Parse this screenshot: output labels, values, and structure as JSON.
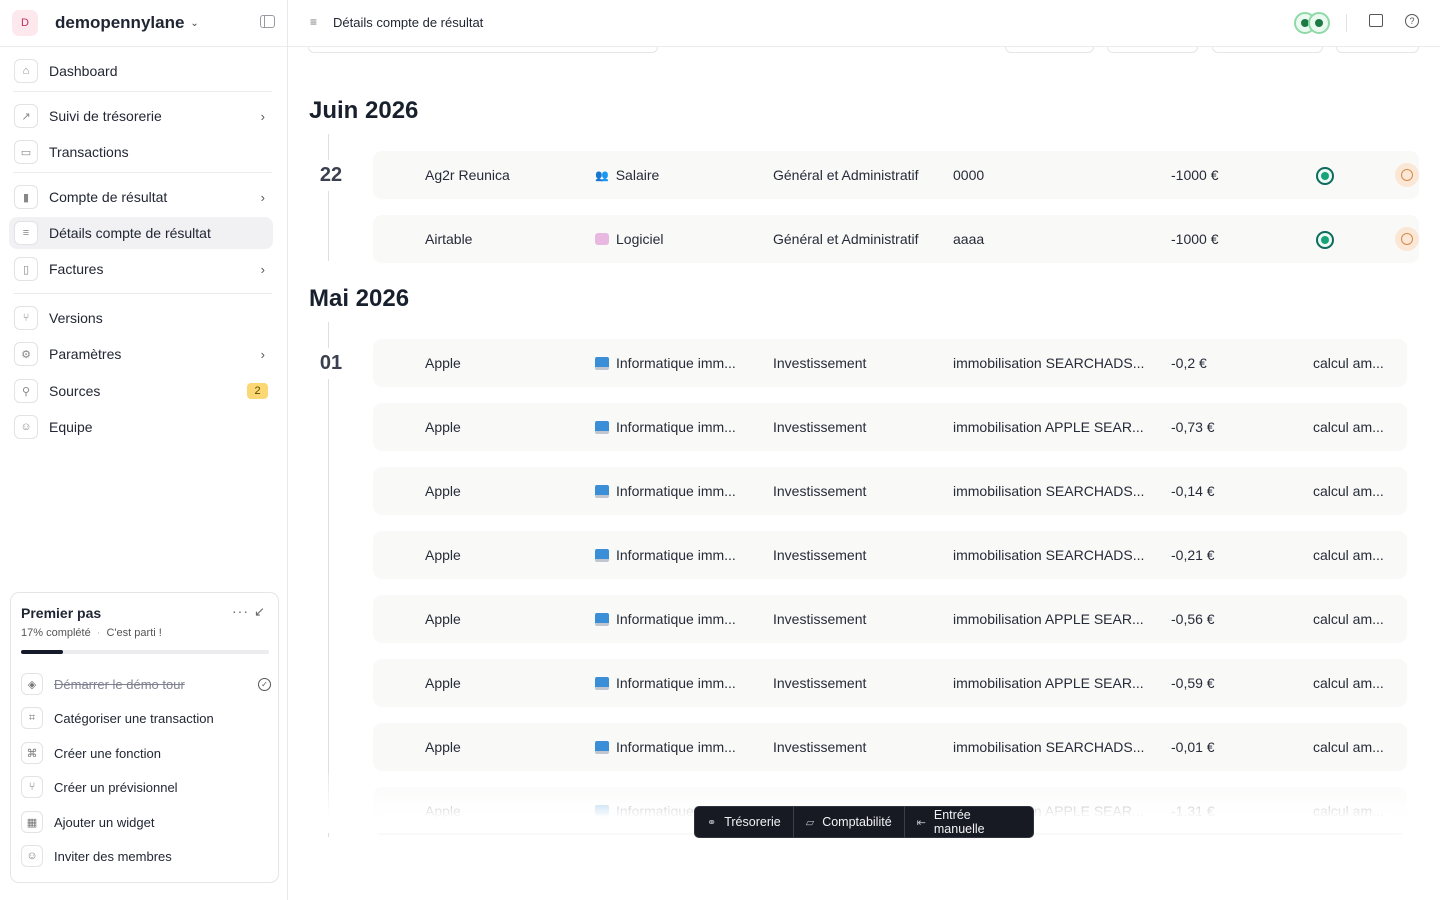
{
  "workspace": {
    "avatar": "D",
    "name": "demopennylane"
  },
  "nav": {
    "dashboard": "Dashboard",
    "suivi": "Suivi de trésorerie",
    "transactions": "Transactions",
    "compte": "Compte de résultat",
    "details": "Détails compte de résultat",
    "factures": "Factures",
    "versions": "Versions",
    "parametres": "Paramètres",
    "sources": "Sources",
    "sources_badge": "2",
    "equipe": "Equipe"
  },
  "onboarding": {
    "title": "Premier pas",
    "progress_text": "17% complété",
    "progress_sub": "C'est parti !",
    "progress": 0.17,
    "items": [
      "Démarrer le démo tour",
      "Catégoriser une transaction",
      "Créer une fonction",
      "Créer un prévisionnel",
      "Ajouter un widget",
      "Inviter des membres"
    ]
  },
  "header": {
    "title": "Détails compte de résultat"
  },
  "sections": [
    {
      "month": "Juin 2026",
      "day": "22",
      "rows": [
        {
          "name": "Ag2r Reunica",
          "category": "Salaire",
          "group": "Général et Administratif",
          "description": "0000",
          "amount": "-1000 €",
          "note": ""
        },
        {
          "name": "Airtable",
          "category": "Logiciel",
          "group": "Général et Administratif",
          "description": "aaaa",
          "amount": "-1000 €",
          "note": ""
        }
      ]
    },
    {
      "month": "Mai 2026",
      "day": "01",
      "rows": [
        {
          "name": "Apple",
          "category": "Informatique imm...",
          "group": "Investissement",
          "description": "immobilisation SEARCHADS...",
          "amount": "-0,2 €",
          "note": "calcul am..."
        },
        {
          "name": "Apple",
          "category": "Informatique imm...",
          "group": "Investissement",
          "description": "immobilisation APPLE SEAR...",
          "amount": "-0,73 €",
          "note": "calcul am..."
        },
        {
          "name": "Apple",
          "category": "Informatique imm...",
          "group": "Investissement",
          "description": "immobilisation SEARCHADS...",
          "amount": "-0,14 €",
          "note": "calcul am..."
        },
        {
          "name": "Apple",
          "category": "Informatique imm...",
          "group": "Investissement",
          "description": "immobilisation SEARCHADS...",
          "amount": "-0,21 €",
          "note": "calcul am..."
        },
        {
          "name": "Apple",
          "category": "Informatique imm...",
          "group": "Investissement",
          "description": "immobilisation APPLE SEAR...",
          "amount": "-0,56 €",
          "note": "calcul am..."
        },
        {
          "name": "Apple",
          "category": "Informatique imm...",
          "group": "Investissement",
          "description": "immobilisation APPLE SEAR...",
          "amount": "-0,59 €",
          "note": "calcul am..."
        },
        {
          "name": "Apple",
          "category": "Informatique imm...",
          "group": "Investissement",
          "description": "immobilisation SEARCHADS...",
          "amount": "-0,01 €",
          "note": "calcul am..."
        },
        {
          "name": "Apple",
          "category": "Informatique imm...",
          "group": "Investissement",
          "description": "immobilisation APPLE SEAR...",
          "amount": "-1,31 €",
          "note": "calcul am..."
        }
      ]
    }
  ],
  "toolbar": {
    "tresorerie": "Trésorerie",
    "comptabilite": "Comptabilité",
    "entree": "Entrée manuelle"
  },
  "colors": {
    "accent": "#141a2a",
    "badge": "#fbd873",
    "status": "#17a37a",
    "row_bg": "#f9f9f8"
  }
}
